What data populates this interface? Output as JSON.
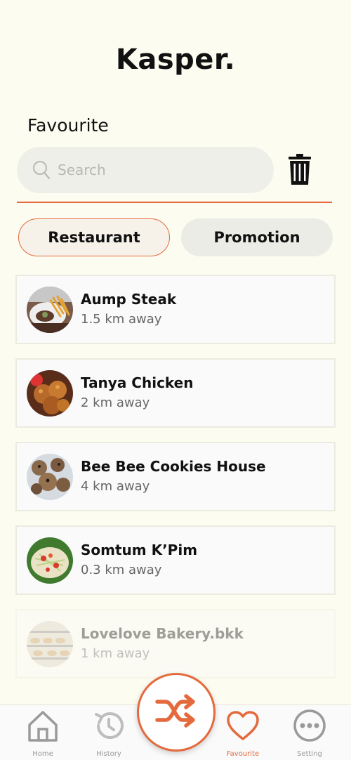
{
  "app": {
    "title": "Kasper."
  },
  "page": {
    "section_title": "Favourite"
  },
  "search": {
    "placeholder": "Search",
    "value": ""
  },
  "tabs": [
    {
      "label": "Restaurant",
      "active": true
    },
    {
      "label": "Promotion",
      "active": false
    }
  ],
  "favourites": [
    {
      "name": "Aump Steak",
      "distance": "1.5 km away",
      "thumb_icon": "steak-fries-photo"
    },
    {
      "name": "Tanya Chicken",
      "distance": "2 km away",
      "thumb_icon": "fried-chicken-photo"
    },
    {
      "name": "Bee Bee Cookies House",
      "distance": "4 km away",
      "thumb_icon": "cookies-photo"
    },
    {
      "name": "Somtum K’Pim",
      "distance": "0.3 km away",
      "thumb_icon": "papaya-salad-photo"
    },
    {
      "name": "Lovelove Bakery.bkk",
      "distance": "1 km away",
      "thumb_icon": "bakery-photo"
    }
  ],
  "nav": [
    {
      "label": "Home",
      "icon": "home-icon",
      "active": false
    },
    {
      "label": "History",
      "icon": "history-icon",
      "active": false
    },
    {
      "label": "Favourite",
      "icon": "heart-icon",
      "active": true
    },
    {
      "label": "Setting",
      "icon": "more-icon",
      "active": false
    }
  ],
  "colors": {
    "accent": "#e46a3d",
    "background": "#fdfcf1",
    "search_bg": "#efefe9",
    "card_bg": "#fafafa"
  }
}
